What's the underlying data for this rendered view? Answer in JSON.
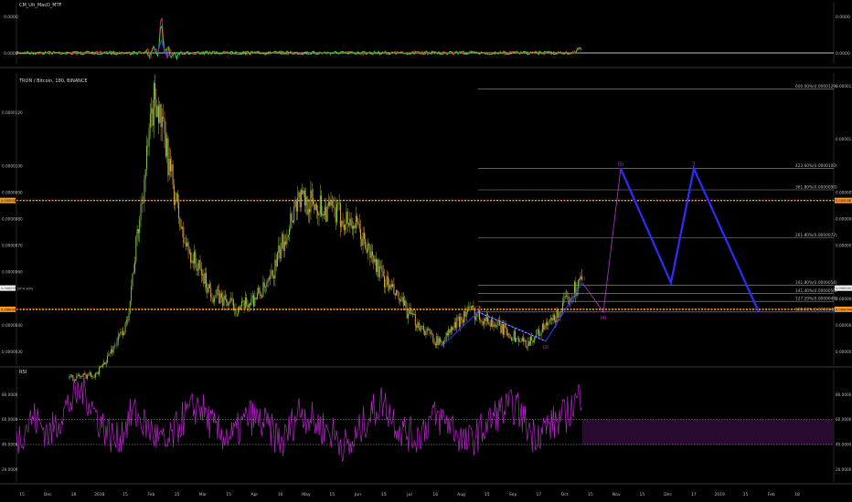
{
  "colors": {
    "background": "#000000",
    "grid": "#2a2a2a",
    "axis_text": "#bdbdbd",
    "candle_up": "#7fbf3f",
    "candle_down": "#d9a441",
    "wick": "#6a6a6a",
    "resistance": "#ff9a1f",
    "fib_line": "#9a9a9a",
    "wave_line": "#2d2dff",
    "wave_label": "#b03cc8",
    "macd_fast": "#e83333",
    "macd_slow": "#2bd12b",
    "macd_signal": "#3a3af0",
    "rsi_line": "#b426c6",
    "rsi_band": "#2a0a30",
    "zero_line": "#ffffff",
    "tag_text": "#000000"
  },
  "panes": {
    "macd": {
      "title": "CM_Ult_MacD_MTF",
      "y_ticks": [
        "0.0000",
        "0.0000"
      ],
      "right_ticks": [
        "0.0000",
        "0.0000"
      ]
    },
    "price": {
      "title": "TRON / Bitcoin, 180, BINANCE",
      "y_ticks": [
        "0.0000120",
        "0.0000100",
        "0.0000090",
        "0.0000080",
        "0.0000070",
        "0.0000060",
        "0.0000040",
        "0.0000030"
      ],
      "right_ticks": [
        "0.0000130",
        "0.0000110",
        "0.0000090",
        "0.0000080",
        "0.0000070",
        "0.0000050",
        "0.0000040",
        "0.0000030"
      ],
      "level_tags_left": [
        "0.0000087",
        "0.0000054",
        "0.0000047"
      ],
      "level_tags_right": [
        "0.0000087",
        "0.0000053",
        "0.0000046"
      ],
      "tag_label": "DT:4 30%"
    },
    "rsi": {
      "title": "RSI",
      "y_ticks": [
        "80.0000",
        "60.0000",
        "40.0000",
        "20.0000"
      ],
      "right_ticks": [
        "80.0000",
        "60.0000",
        "40.0000",
        "20.0000"
      ]
    }
  },
  "x_axis": {
    "labels": [
      "15",
      "Dec",
      "18",
      "2018",
      "15",
      "Feb",
      "15",
      "Mar",
      "15",
      "Apr",
      "16",
      "May",
      "15",
      "Jun",
      "15",
      "Jul",
      "16",
      "Aug",
      "15",
      "Sep",
      "17",
      "Oct",
      "15",
      "Nov",
      "15",
      "Dec",
      "17",
      "2019",
      "15",
      "Feb",
      "18"
    ]
  },
  "chart_data": [
    {
      "type": "line",
      "pane": "macd",
      "title": "CM_Ult_MacD_MTF",
      "x_range": [
        0,
        1
      ],
      "ylim": [
        -1,
        1
      ],
      "series": [
        {
          "name": "",
          "description_points": [
            0.02,
            0.08,
            0.16,
            0.21,
            0.24,
            0.3,
            0.4,
            0.5,
            0.6,
            0.7,
            0.8,
            0.9,
            0.99
          ]
        }
      ],
      "spike_position": 0.16
    },
    {
      "type": "line",
      "pane": "price",
      "title": "TRON / Bitcoin, 180, BINANCE",
      "ylim": [
        2.5e-06,
        1.35e-05
      ],
      "series": [
        {
          "name": "",
          "x": [
            "Nov 15",
            "Dec",
            "2018",
            "Jan 10",
            "Jan 15",
            "Feb",
            "Mar",
            "Apr",
            "May",
            "May 15",
            "Jun",
            "Jul",
            "Aug",
            "Sep",
            "Oct",
            "Nov",
            "Dec",
            "Dec 15",
            "Dec 25"
          ],
          "values": [
            2e-06,
            2.2e-06,
            4e-06,
            1.28e-05,
            7.2e-06,
            5.2e-06,
            4.6e-06,
            5.5e-06,
            8.8e-06,
            8.4e-06,
            7.8e-06,
            5.8e-06,
            4.3e-06,
            3.3e-06,
            4.6e-06,
            4e-06,
            3.3e-06,
            4.2e-06,
            5.8e-06
          ]
        }
      ],
      "horizontal_levels": [
        {
          "label": "0.0000087",
          "value": 8.7e-06
        },
        {
          "label": "0.0000046",
          "value": 4.6e-06
        }
      ],
      "fib_levels": [
        {
          "label": "600.00%(0.0000129)",
          "value": 1.29e-05
        },
        {
          "label": "423.60%(0.0000100)",
          "value": 9.9e-06
        },
        {
          "label": "361.80%(0.0000090)",
          "value": 9.1e-06
        },
        {
          "label": "261.80%(0.0000072)",
          "value": 7.3e-06
        },
        {
          "label": "161.80%(0.0000054)",
          "value": 5.5e-06
        },
        {
          "label": "141.40%(0.0000050)",
          "value": 5.2e-06
        },
        {
          "label": "127.20%(0.0000048)",
          "value": 4.9e-06
        },
        {
          "label": "100.00%(0.0000043)",
          "value": 4.5e-06
        }
      ],
      "wave_points": [
        {
          "label": "",
          "x": "Sep 17",
          "value": 3.2e-06
        },
        {
          "label": "(1)",
          "x": "Oct",
          "value": 4.5e-06
        },
        {
          "label": "(2)",
          "x": "Dec",
          "value": 3.4e-06
        },
        {
          "label": "(3)",
          "x": "Dec 25",
          "value": 5.6e-06
        },
        {
          "label": "(4)",
          "x": "Jan",
          "value": 4.5e-06
        },
        {
          "label": "(5)",
          "x": "Jan 15",
          "value": 9.9e-06
        },
        {
          "label": "",
          "x": "Feb 10",
          "value": 5.6e-06
        },
        {
          "label": "3",
          "x": "Feb 20",
          "value": 9.9e-06
        },
        {
          "label": "",
          "x": "Mar 15",
          "value": 4.5e-06
        }
      ]
    },
    {
      "type": "line",
      "pane": "rsi",
      "title": "RSI",
      "ylim": [
        10,
        100
      ],
      "bands": [
        40,
        60
      ],
      "series": [
        {
          "name": "RSI",
          "values": [
            44,
            62,
            48,
            70,
            85,
            58,
            42,
            66,
            52,
            38,
            61,
            72,
            50,
            46,
            63,
            55,
            41,
            68,
            57,
            49,
            36,
            60,
            75,
            53,
            45,
            62,
            58,
            40,
            52,
            66,
            71,
            48,
            55,
            63,
            82
          ]
        }
      ]
    }
  ]
}
